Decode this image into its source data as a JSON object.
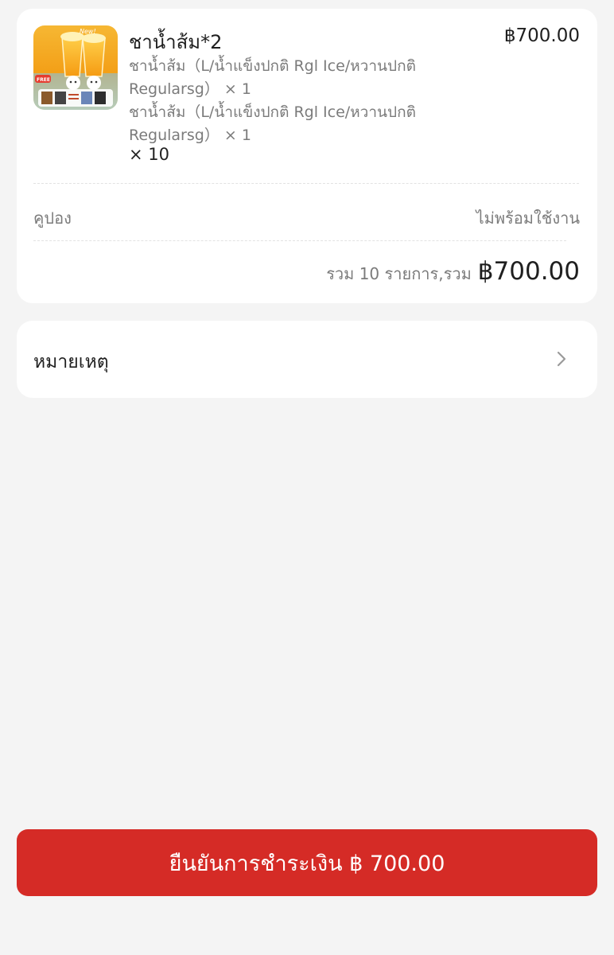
{
  "order": {
    "item": {
      "image_alt": "ชาน้ำส้ม",
      "image_badge": "New!",
      "image_promo": "FREE",
      "title": "ชาน้ำส้ม*2",
      "price": "฿700.00",
      "options": [
        {
          "line1": "ชาน้ำส้ม（L/น้ำแข็งปกติ Rgl Ice/หวานปกติ",
          "line2": "Regularsg）  × 1"
        },
        {
          "line1": "ชาน้ำส้ม（L/น้ำแข็งปกติ Rgl Ice/หวานปกติ",
          "line2": "Regularsg）  × 1"
        }
      ],
      "quantity": "× 10"
    },
    "coupon": {
      "label": "คูปอง",
      "status": "ไม่พร้อมใช้งาน"
    },
    "summary": {
      "text": "รวม 10 รายการ,รวม",
      "amount": "฿700.00"
    }
  },
  "note": {
    "label": "หมายเหตุ"
  },
  "payment": {
    "button_label": "ยืนยันการชำระเงิน ฿ 700.00"
  },
  "colors": {
    "accent": "#d52b26",
    "background": "#f4f4f4",
    "secondary_text": "#7b7b7b"
  },
  "icons": {
    "note_arrow": "chevron-right-icon"
  }
}
